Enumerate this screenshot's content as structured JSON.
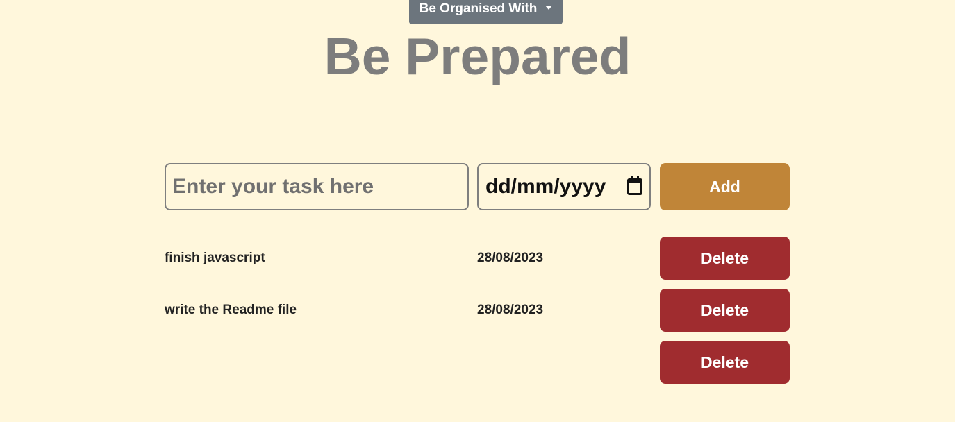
{
  "header": {
    "dropdown_label": "Be Organised With",
    "title": "Be Prepared"
  },
  "form": {
    "task_placeholder": "Enter your task here",
    "task_value": "",
    "date_placeholder": "dd/mm/yyyy",
    "add_label": "Add"
  },
  "tasks": [
    {
      "name": "finish javascript",
      "date": "28/08/2023",
      "delete_label": "Delete"
    },
    {
      "name": "write the Readme file",
      "date": "28/08/2023",
      "delete_label": "Delete"
    },
    {
      "name": "",
      "date": "",
      "delete_label": "Delete"
    }
  ],
  "colors": {
    "background": "#fff7dc",
    "dropdown": "#6c757d",
    "add": "#c08538",
    "delete": "#a02c2f",
    "title": "#7d7d7d"
  }
}
